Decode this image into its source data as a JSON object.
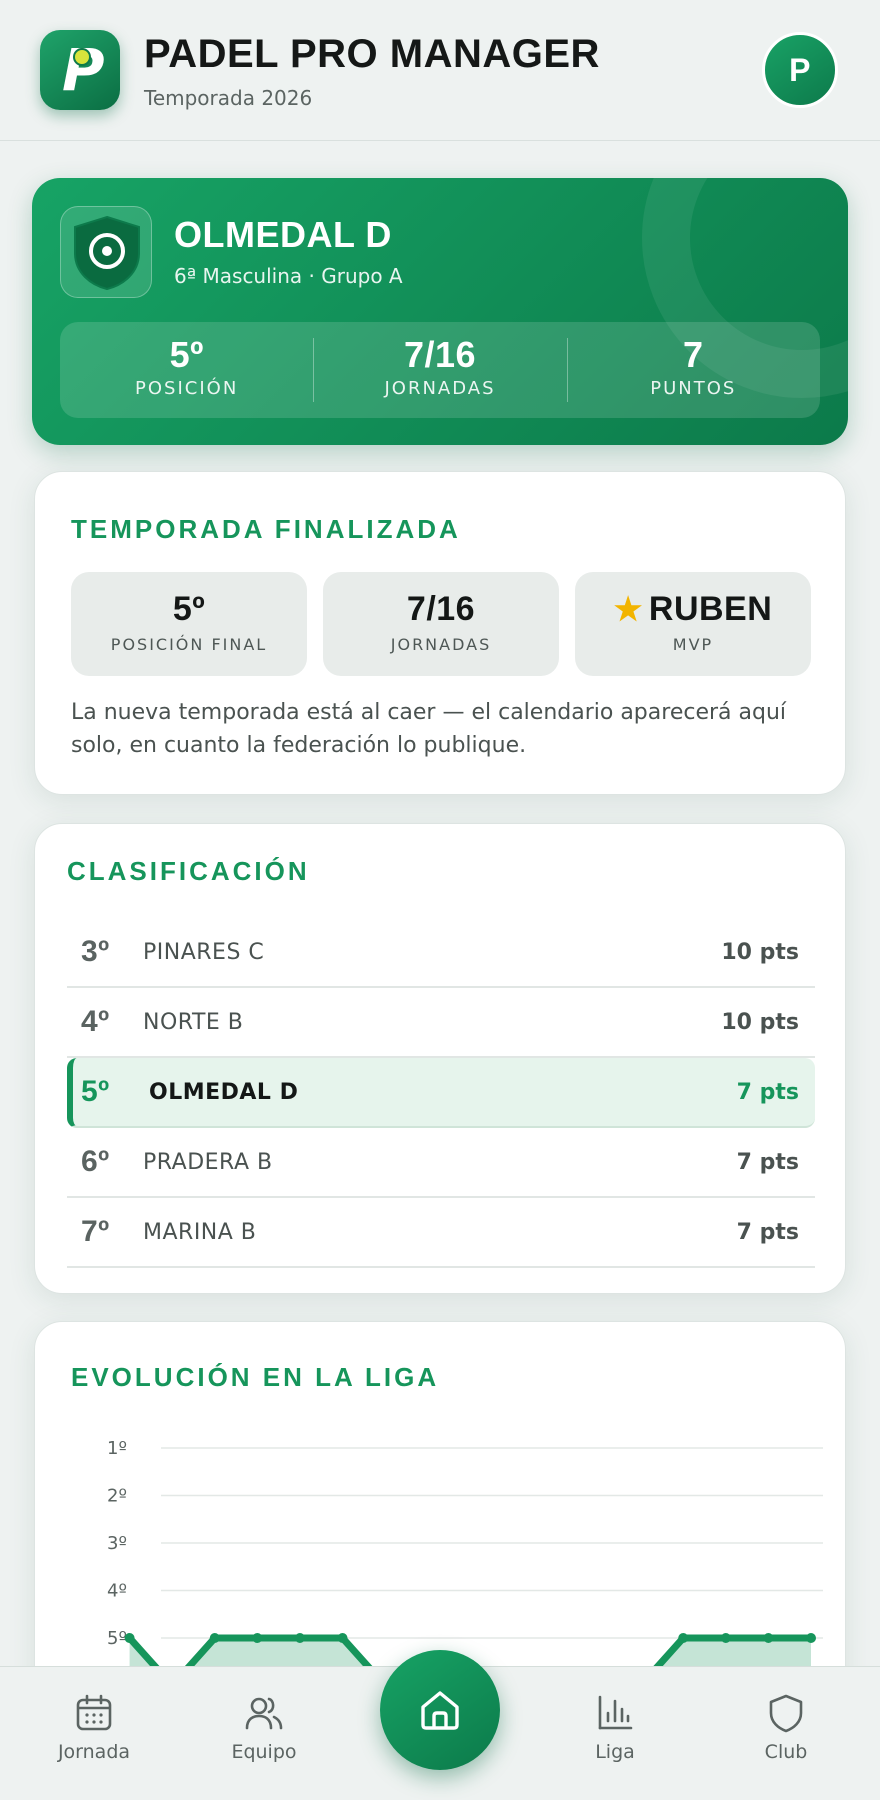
{
  "header": {
    "app_title": "PADEL PRO MANAGER",
    "season": "Temporada 2026",
    "avatar_initial": "P"
  },
  "team": {
    "name": "OLMEDAL D",
    "league": "6ª Masculina · Grupo A",
    "stats": [
      {
        "value": "5º",
        "label": "POSICIÓN"
      },
      {
        "value": "7/16",
        "label": "JORNADAS"
      },
      {
        "value": "7",
        "label": "PUNTOS"
      }
    ]
  },
  "season_summary": {
    "title": "TEMPORADA FINALIZADA",
    "tiles": [
      {
        "value": "5º",
        "label": "POSICIÓN FINAL"
      },
      {
        "value": "7/16",
        "label": "JORNADAS"
      },
      {
        "value": "RUBEN",
        "label": "MVP",
        "icon": "star-icon"
      }
    ],
    "note": "La nueva temporada está al caer — el calendario aparecerá aquí solo, en cuanto la federación lo publique."
  },
  "standings": {
    "title": "CLASIFICACIÓN",
    "rows": [
      {
        "pos": "3º",
        "team": "PINARES C",
        "pts": "10 pts"
      },
      {
        "pos": "4º",
        "team": "NORTE B",
        "pts": "10 pts"
      },
      {
        "pos": "5º",
        "team": "OLMEDAL D",
        "pts": "7 pts",
        "active": true
      },
      {
        "pos": "6º",
        "team": "PRADERA B",
        "pts": "7 pts"
      },
      {
        "pos": "7º",
        "team": "MARINA B",
        "pts": "7 pts"
      }
    ]
  },
  "evolution": {
    "title": "EVOLUCIÓN EN LA LIGA",
    "accent": "#16955b"
  },
  "chart_data": {
    "type": "area",
    "title": "EVOLUCIÓN EN LA LIGA",
    "xlabel": "",
    "ylabel": "",
    "y_tick_labels": [
      "1º",
      "2º",
      "3º",
      "4º",
      "5º"
    ],
    "y_reversed": true,
    "ylim": [
      1,
      5
    ],
    "x": [
      1,
      2,
      3,
      4,
      5,
      6,
      7,
      8,
      9,
      10,
      11,
      12,
      13,
      14,
      15,
      16,
      17,
      18
    ],
    "values": [
      null,
      5,
      6,
      5,
      5,
      5,
      5,
      6,
      null,
      null,
      null,
      null,
      null,
      6,
      5,
      5,
      5,
      5
    ],
    "grid": true,
    "legend": "none"
  },
  "nav": {
    "items": [
      {
        "label": "Jornada",
        "icon": "calendar-icon"
      },
      {
        "label": "Equipo",
        "icon": "users-icon"
      },
      {
        "label": "Liga",
        "icon": "bar-chart-icon"
      },
      {
        "label": "Club",
        "icon": "shield-icon"
      }
    ],
    "home_icon": "home-icon"
  }
}
